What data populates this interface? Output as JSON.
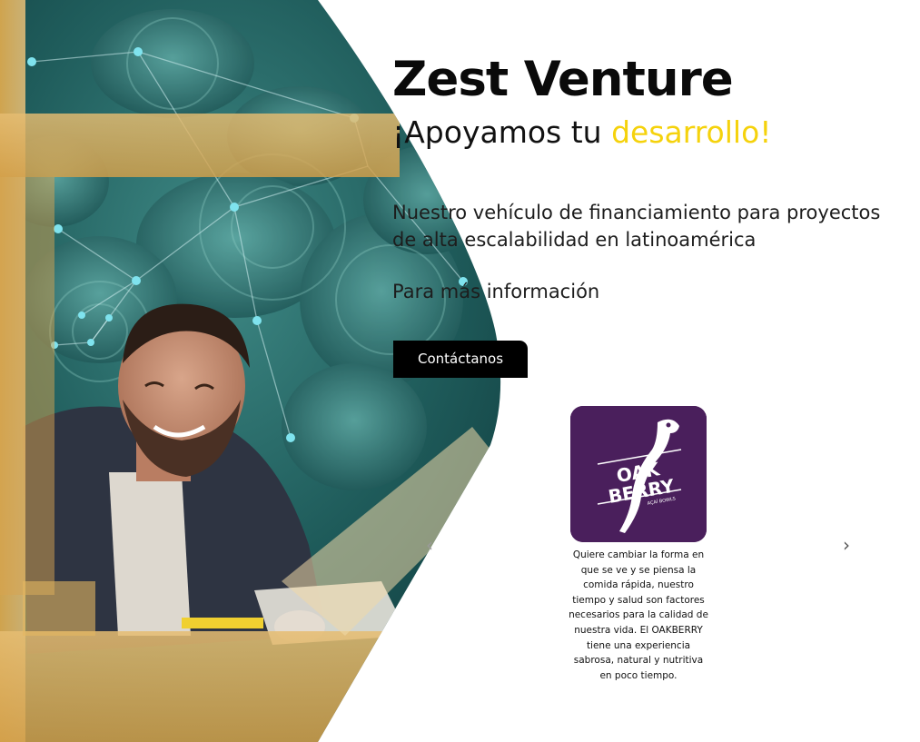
{
  "header": {
    "title": "Zest Venture",
    "tagline_prefix": "¡Apoyamos tu ",
    "tagline_accent": "desarrollo!"
  },
  "intro": {
    "description": "Nuestro vehículo de financiamiento para proyectos de alta escalabilidad en latinoamérica",
    "more_info": "Para más información",
    "contact_label": "Contáctanos"
  },
  "carousel": {
    "prev_icon": "chevron-left-icon",
    "next_icon": "chevron-right-icon",
    "slides": [
      {
        "logo_name": "OAK BERRY",
        "logo_word1": "OAK",
        "logo_word2": "BERRY",
        "logo_sub": "AÇAÍ BOWLS",
        "text": "Quiere cambiar la forma en que se ve y se piensa la comida rápida, nuestro tiempo y salud son factores necesarios para la calidad de nuestra vida.  El OAKBERRY tiene una experiencia sabrosa, natural y nutritiva en poco tiempo."
      }
    ]
  },
  "colors": {
    "accent": "#f5d20c",
    "button_bg": "#000000",
    "logo_bg": "#4a1f5c"
  }
}
